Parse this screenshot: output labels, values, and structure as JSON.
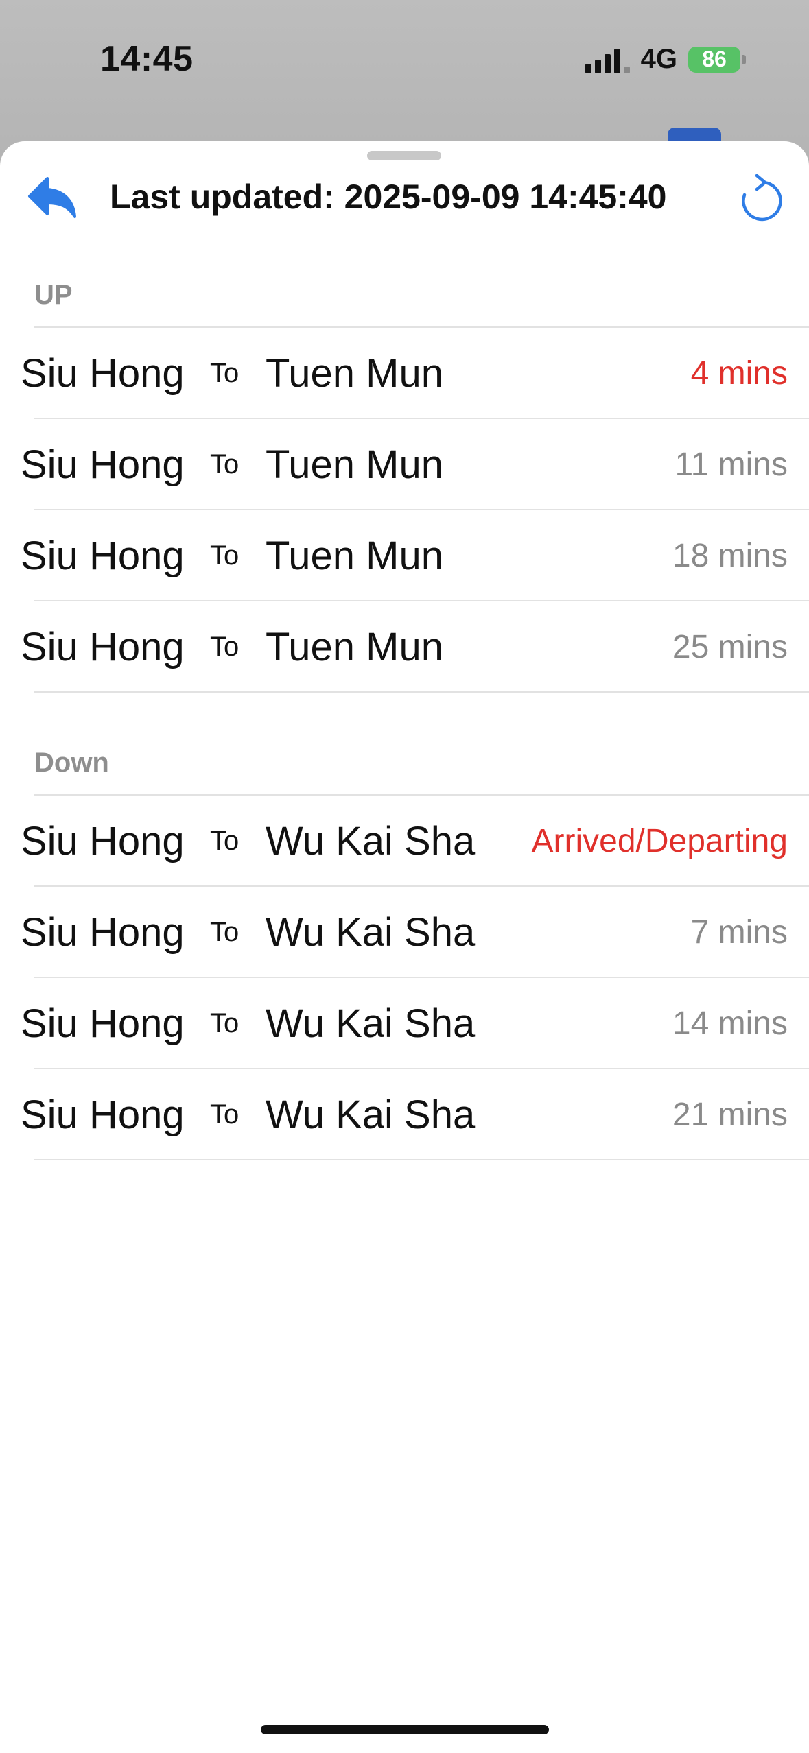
{
  "status_bar": {
    "time": "14:45",
    "network": "4G",
    "battery": "86"
  },
  "header": {
    "title": "Last updated: 2025-09-09 14:45:40",
    "back_icon": "reply-arrow-icon",
    "refresh_icon": "refresh-icon",
    "accent_color": "#2f7de6"
  },
  "sections": [
    {
      "title": "UP",
      "rows": [
        {
          "from": "Siu Hong",
          "to_word": "To",
          "destination": "Tuen Mun",
          "eta": "4 mins",
          "alert": true
        },
        {
          "from": "Siu Hong",
          "to_word": "To",
          "destination": "Tuen Mun",
          "eta": "11 mins",
          "alert": false
        },
        {
          "from": "Siu Hong",
          "to_word": "To",
          "destination": "Tuen Mun",
          "eta": "18 mins",
          "alert": false
        },
        {
          "from": "Siu Hong",
          "to_word": "To",
          "destination": "Tuen Mun",
          "eta": "25 mins",
          "alert": false
        }
      ]
    },
    {
      "title": "Down",
      "rows": [
        {
          "from": "Siu Hong",
          "to_word": "To",
          "destination": "Wu Kai Sha",
          "eta": "Arrived/Departing",
          "alert": true
        },
        {
          "from": "Siu Hong",
          "to_word": "To",
          "destination": "Wu Kai Sha",
          "eta": "7 mins",
          "alert": false
        },
        {
          "from": "Siu Hong",
          "to_word": "To",
          "destination": "Wu Kai Sha",
          "eta": "14 mins",
          "alert": false
        },
        {
          "from": "Siu Hong",
          "to_word": "To",
          "destination": "Wu Kai Sha",
          "eta": "21 mins",
          "alert": false
        }
      ]
    }
  ]
}
